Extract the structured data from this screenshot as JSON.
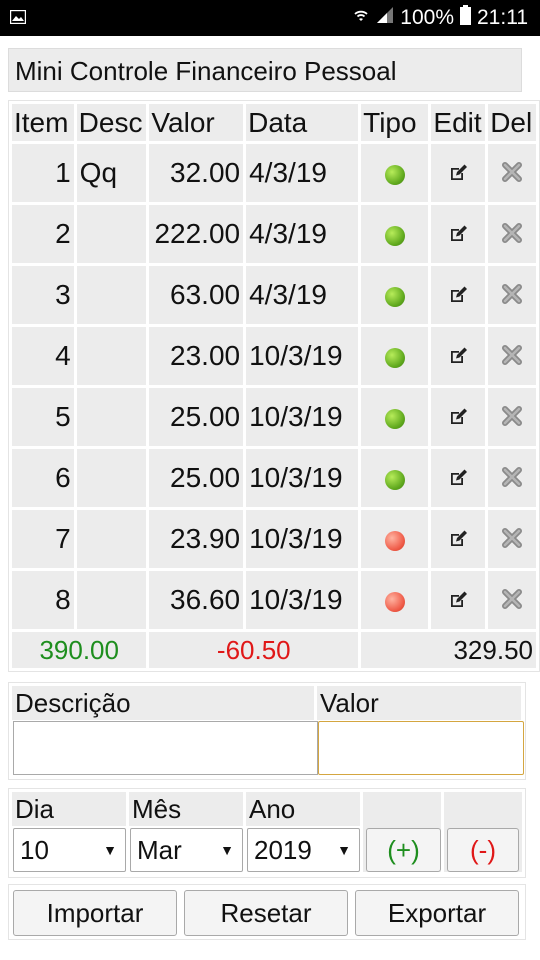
{
  "status_bar": {
    "battery": "100%",
    "time": "21:11"
  },
  "app": {
    "title": "Mini Controle Financeiro Pessoal"
  },
  "table": {
    "headers": [
      "Item",
      "Desc",
      "Valor",
      "Data",
      "Tipo",
      "Edit",
      "Del"
    ],
    "rows": [
      {
        "item": "1",
        "desc": "Qq",
        "valor": "32.00",
        "data": "4/3/19",
        "tipo": "income"
      },
      {
        "item": "2",
        "desc": "",
        "valor": "222.00",
        "data": "4/3/19",
        "tipo": "income"
      },
      {
        "item": "3",
        "desc": "",
        "valor": "63.00",
        "data": "4/3/19",
        "tipo": "income"
      },
      {
        "item": "4",
        "desc": "",
        "valor": "23.00",
        "data": "10/3/19",
        "tipo": "income"
      },
      {
        "item": "5",
        "desc": "",
        "valor": "25.00",
        "data": "10/3/19",
        "tipo": "income"
      },
      {
        "item": "6",
        "desc": "",
        "valor": "25.00",
        "data": "10/3/19",
        "tipo": "income"
      },
      {
        "item": "7",
        "desc": "",
        "valor": "23.90",
        "data": "10/3/19",
        "tipo": "expense"
      },
      {
        "item": "8",
        "desc": "",
        "valor": "36.60",
        "data": "10/3/19",
        "tipo": "expense"
      }
    ],
    "totals": {
      "income": "390.00",
      "expense": "-60.50",
      "net": "329.50"
    }
  },
  "form": {
    "descricao_label": "Descrição",
    "valor_label": "Valor",
    "descricao_value": "",
    "valor_value": "",
    "dia_label": "Dia",
    "mes_label": "Mês",
    "ano_label": "Ano",
    "dia_value": "10",
    "mes_value": "Mar",
    "ano_value": "2019",
    "add_label": "(+)",
    "sub_label": "(-)"
  },
  "actions": {
    "importar": "Importar",
    "resetar": "Resetar",
    "exportar": "Exportar"
  },
  "colors": {
    "income": "#6cbf2a",
    "expense": "#ef5b48",
    "total_income": "#1e8e1e",
    "total_expense": "#e01818"
  },
  "icons": {
    "tipo_income": "green-dot-icon",
    "tipo_expense": "red-dot-icon",
    "edit": "edit-icon",
    "delete": "delete-x-icon"
  }
}
